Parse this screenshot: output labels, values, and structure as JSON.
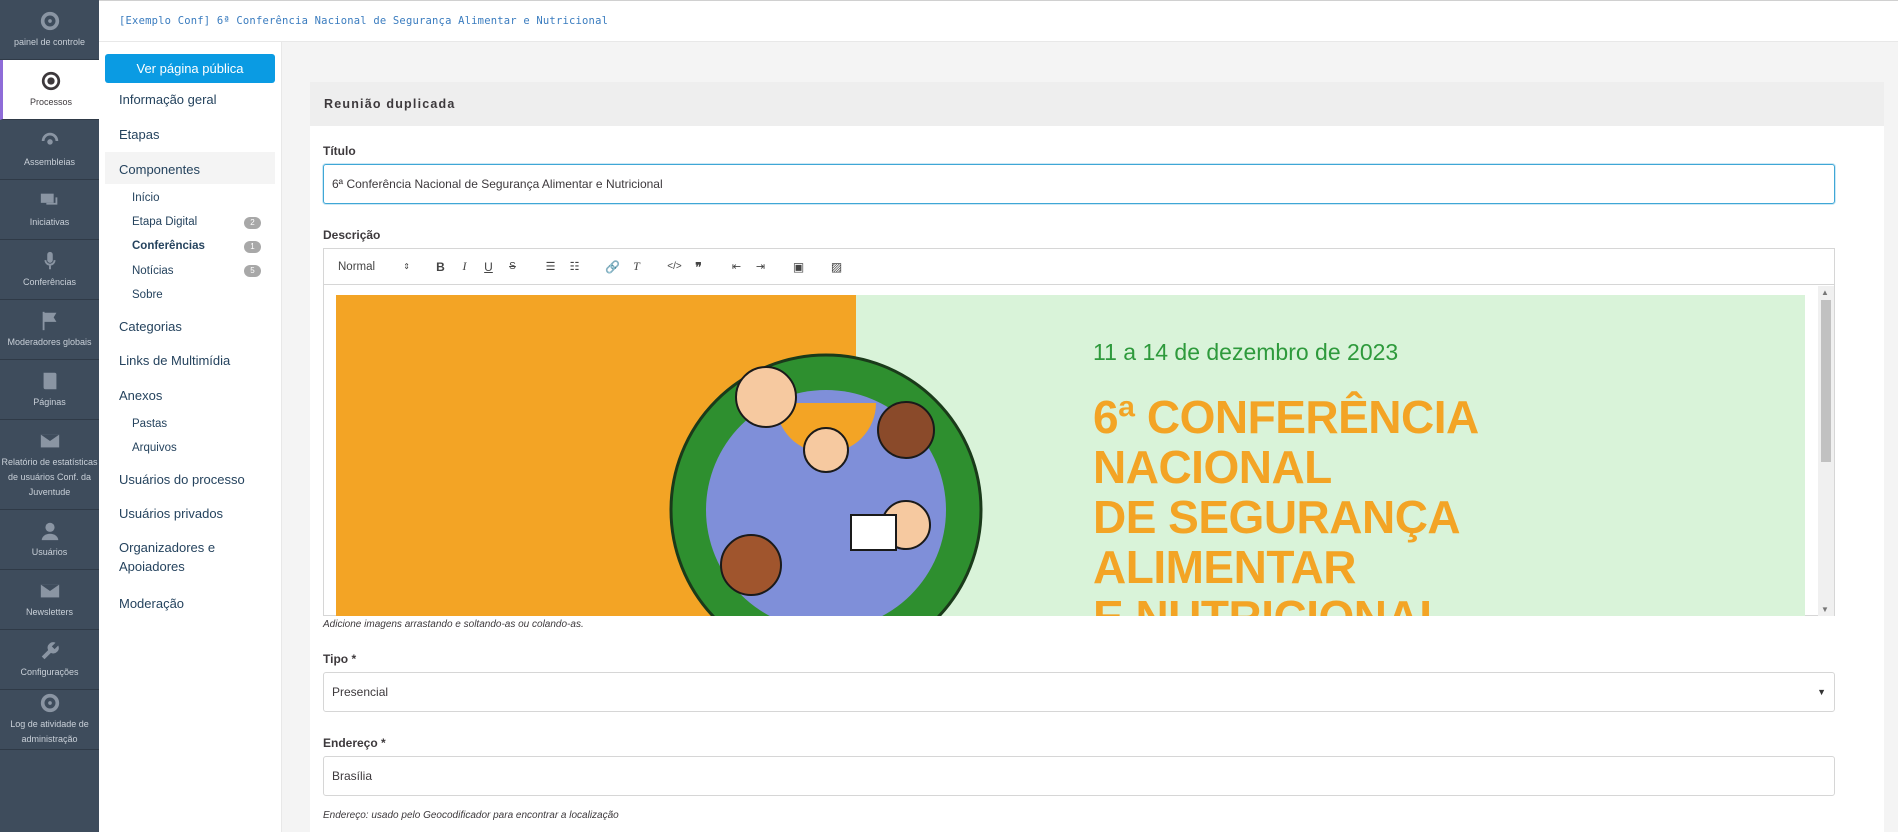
{
  "mainnav": [
    {
      "label": "painel de controle",
      "icon": "dashboard-icon"
    },
    {
      "label": "Processos",
      "icon": "target-icon",
      "active": true
    },
    {
      "label": "Assembleias",
      "icon": "assembly-icon"
    },
    {
      "label": "Iniciativas",
      "icon": "chat-icon"
    },
    {
      "label": "Conferências",
      "icon": "microphone-icon"
    },
    {
      "label": "Moderadores globais",
      "icon": "flag-icon"
    },
    {
      "label": "Páginas",
      "icon": "book-icon"
    },
    {
      "label": "Relatório de estatísticas de usuários Conf. da Juventude",
      "icon": "mail-icon"
    },
    {
      "label": "Usuários",
      "icon": "user-icon"
    },
    {
      "label": "Newsletters",
      "icon": "envelope-icon"
    },
    {
      "label": "Configurações",
      "icon": "wrench-icon"
    },
    {
      "label": "Log de atividade de administração",
      "icon": "activity-icon"
    }
  ],
  "topbar": {
    "breadcrumb": "[Exemplo Conf] 6ª Conferência Nacional de Segurança Alimentar e Nutricional"
  },
  "secnav": {
    "public_button": "Ver página pública",
    "items": {
      "info": "Informação geral",
      "steps": "Etapas",
      "components": "Componentes",
      "categories": "Categorias",
      "media": "Links de Multimídia",
      "attachments": "Anexos",
      "process_users": "Usuários do processo",
      "private_users": "Usuários privados",
      "organizers_line1": "Organizadores e",
      "organizers_line2": "Apoiadores",
      "moderation": "Moderação"
    },
    "components": [
      {
        "label": "Início",
        "badge": ""
      },
      {
        "label": "Etapa Digital",
        "badge": "2"
      },
      {
        "label": "Conferências",
        "badge": "1"
      },
      {
        "label": "Notícias",
        "badge": "5"
      },
      {
        "label": "Sobre",
        "badge": ""
      }
    ],
    "attachments": [
      "Pastas",
      "Arquivos"
    ]
  },
  "form": {
    "header": "Reunião duplicada",
    "title_label": "Título",
    "title_value": "6ª Conferência Nacional de Segurança Alimentar e Nutricional",
    "description_label": "Descrição",
    "editor_format": "Normal",
    "editor_help": "Adicione imagens arrastando e soltando-as ou colando-as.",
    "banner_date": "11 a 14 de dezembro de 2023",
    "banner_line1": "6ª CONFERÊNCIA",
    "banner_line2": "NACIONAL",
    "banner_line3": "DE SEGURANÇA",
    "banner_line4": "ALIMENTAR",
    "banner_line5": "E NUTRICIONAL",
    "type_label": "Tipo *",
    "type_value": "Presencial",
    "address_label": "Endereço *",
    "address_value": "Brasília",
    "address_help": "Endereço: usado pelo Geocodificador para encontrar a localização"
  },
  "colors": {
    "nav_bg": "#3e4c5c",
    "accent": "#0a9be3",
    "banner_orange": "#f3a425",
    "banner_green": "#2e9a3c"
  }
}
